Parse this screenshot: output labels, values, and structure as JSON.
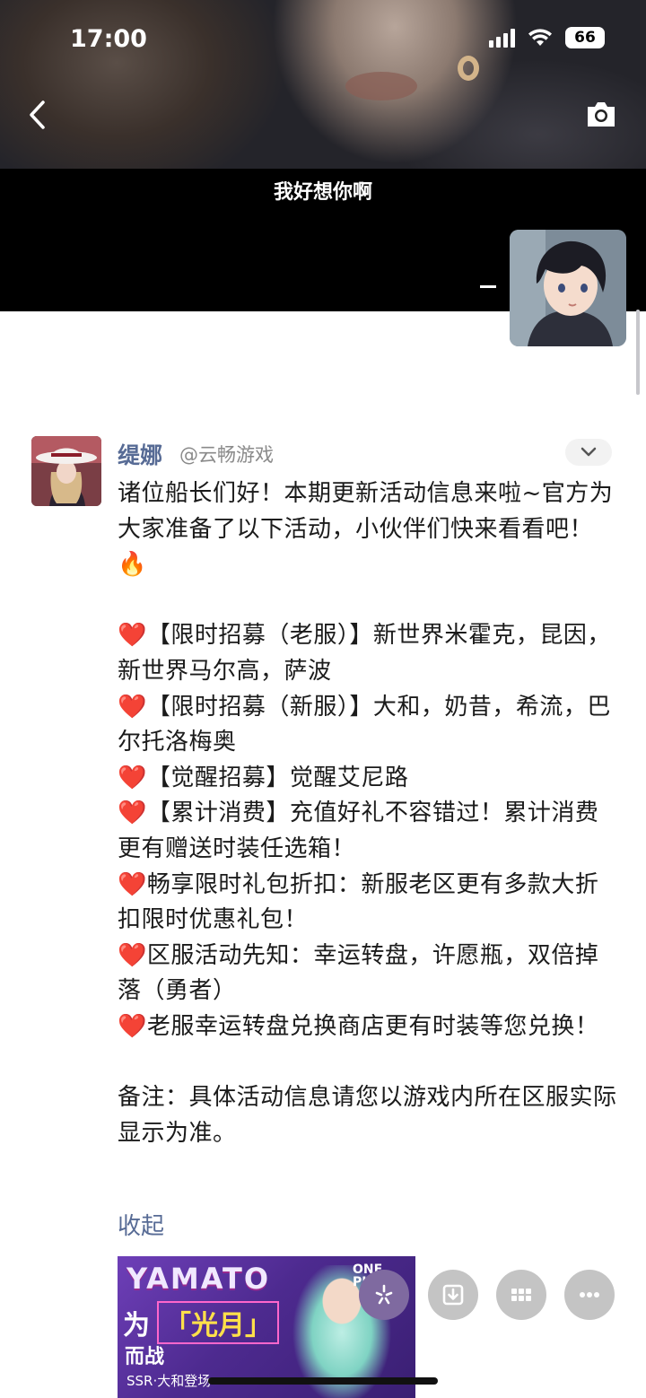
{
  "status_bar": {
    "time": "17:00",
    "battery": "66"
  },
  "video": {
    "subtitle": "我好想你啊"
  },
  "post": {
    "author_name": "缇娜",
    "author_handle": "@云畅游戏",
    "intro_lines": [
      "诸位船长们好！本期更新活动信息来啦~官方为大家准备了以下活动，小伙伴们快来看看吧！"
    ],
    "intro_emoji": "🔥",
    "heart": "❤️",
    "items": [
      "【限时招募（老服）】新世界米霍克，昆因，新世界马尔高，萨波",
      "【限时招募（新服）】大和，奶昔，希流，巴尔托洛梅奥",
      "【觉醒招募】觉醒艾尼路",
      "【累计消费】充值好礼不容错过！累计消费更有赠送时装任选箱！",
      "畅享限时礼包折扣：新服老区更有多款大折扣限时优惠礼包！",
      "区服活动先知：幸运转盘，许愿瓶，双倍掉落（勇者）",
      "老服幸运转盘兑换商店更有时装等您兑换！"
    ],
    "note": "备注：具体活动信息请您以游戏内所在区服实际显示为准。",
    "collapse_label": "收起"
  },
  "image": {
    "title": "YAMATO",
    "line1_prefix": "为",
    "line1_highlight": "「光月」",
    "line2": "而战",
    "ssr_caption": "SSR·大和登场",
    "brand": "ONE PIECE"
  },
  "icons": {
    "back": "chevron-left-icon",
    "camera": "camera-icon",
    "dropdown": "chevron-down-icon",
    "actions": [
      "sparkle-icon",
      "download-icon",
      "grid-icon",
      "more-icon"
    ]
  }
}
